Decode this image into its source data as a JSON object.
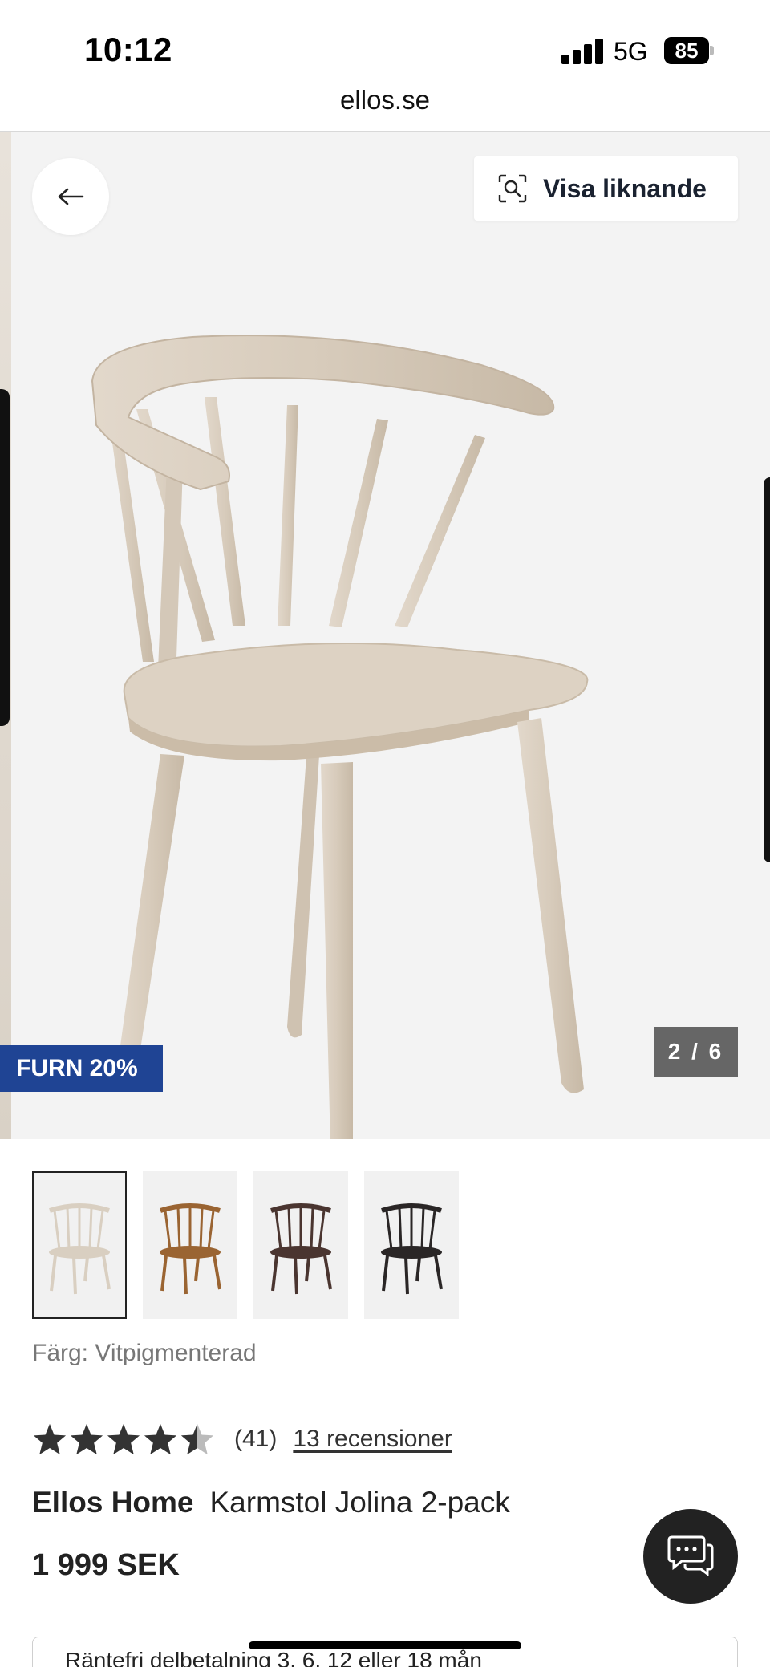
{
  "status_bar": {
    "time": "10:12",
    "network": "5G",
    "battery": "85"
  },
  "browser": {
    "url": "ellos.se"
  },
  "gallery": {
    "visa_liknande_label": "Visa liknande",
    "badge": "FURN 20%",
    "counter": "2 / 6",
    "badge_color": "#1f4494"
  },
  "thumbnails": [
    {
      "color": "#d9cfc1",
      "selected": true
    },
    {
      "color": "#9a6432",
      "selected": false
    },
    {
      "color": "#4a3530",
      "selected": false
    },
    {
      "color": "#2a2626",
      "selected": false
    }
  ],
  "product": {
    "color_label": "Färg: Vitpigmenterad",
    "rating_value": 4.5,
    "rating_count": "(41)",
    "reviews_link": "13 recensioner",
    "brand": "Ellos Home",
    "name": "Karmstol Jolina 2-pack",
    "price": "1 999 SEK",
    "installment_text": "Räntefri delbetalning 3, 6, 12 eller 18 mån"
  }
}
